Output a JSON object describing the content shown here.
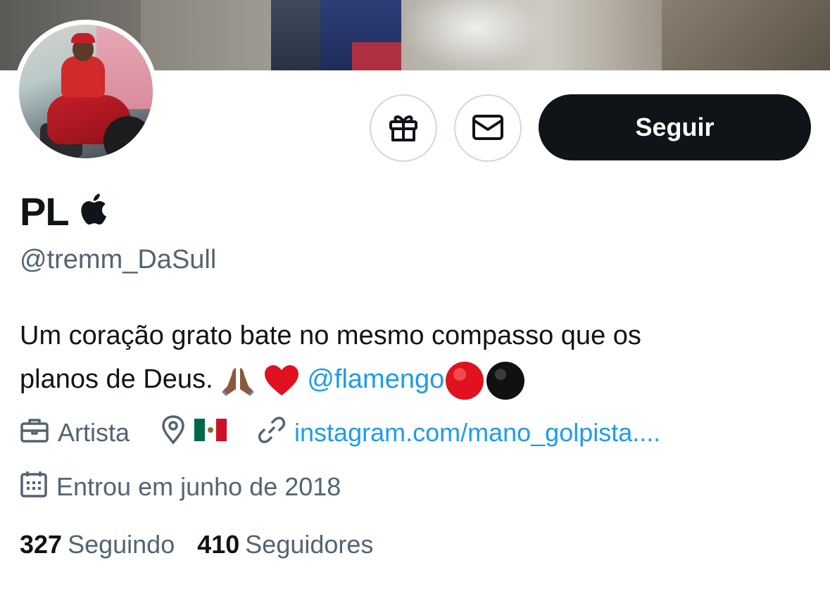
{
  "profile": {
    "display_name": "PL",
    "name_badge_icon": "apple-logo-icon",
    "handle": "@tremm_DaSull",
    "bio": {
      "line1": "Um coração grato bate no mesmo compasso que os",
      "line2_text": "planos de Deus.",
      "mention": "@flamengo"
    },
    "category": "Artista",
    "location_icon": "location-pin-icon",
    "location_flag": "mexico-flag",
    "website": "instagram.com/mano_golpista....",
    "joined": "Entrou em junho de 2018",
    "following_count": "327",
    "following_label": "Seguindo",
    "followers_count": "410",
    "followers_label": "Seguidores"
  },
  "actions": {
    "gift_icon": "gift-icon",
    "message_icon": "mail-icon",
    "follow_label": "Seguir"
  },
  "colors": {
    "text": "#0f1419",
    "secondary": "#536471",
    "link": "#1d9bf0",
    "button_bg": "#0f1419",
    "border": "#cfd9de"
  }
}
